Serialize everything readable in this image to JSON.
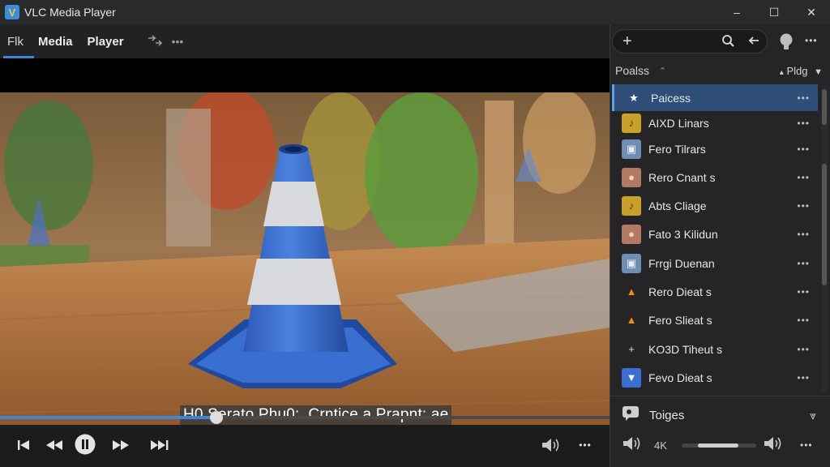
{
  "window": {
    "title": "VLC Media Player",
    "controls": {
      "minimize": "–",
      "maximize": "☐",
      "close": "✕"
    }
  },
  "menu": {
    "items": [
      "Flk",
      "Media",
      "Player"
    ],
    "more_icon": "more-horizontal-icon"
  },
  "video": {
    "subtitle": "H0 Serato Phu0:. Crntice a Prapnt: ae"
  },
  "seek": {
    "progress": 0.355
  },
  "panel": {
    "search_placeholder": "",
    "header_label": "Poalss",
    "header_sort": "Pldg",
    "items": [
      {
        "label": "Paicess",
        "icon": "star-icon",
        "active": true
      },
      {
        "label": "AIXD Linars",
        "icon": "music-thumb-icon",
        "active": false
      },
      {
        "label": "Fero Tilrars",
        "icon": "image-thumb-icon",
        "active": false
      },
      {
        "label": "Rero Cnant s",
        "icon": "person-thumb-icon",
        "active": false
      },
      {
        "label": "Abts Cliage",
        "icon": "music-thumb-icon",
        "active": false
      },
      {
        "label": "Fato 3 Kilidun",
        "icon": "person-thumb-icon",
        "active": false
      },
      {
        "label": "Frrgi Duenan",
        "icon": "image-thumb-icon",
        "active": false
      },
      {
        "label": "Rero Dieat s",
        "icon": "vlc-cone-icon",
        "active": false
      },
      {
        "label": "Fero Slieat s",
        "icon": "vlc-cone-icon",
        "active": false
      },
      {
        "label": "KO3D Tiheut s",
        "icon": "plus-icon",
        "active": false
      },
      {
        "label": "Fevo Dieat s",
        "icon": "chevron-down-circle-icon",
        "active": false
      }
    ],
    "tools_label": "Toiges",
    "volume_label": "4K",
    "volume_level": 0.7
  },
  "colors": {
    "accent": "#3d86d6",
    "active_row": "#2f4f78"
  }
}
